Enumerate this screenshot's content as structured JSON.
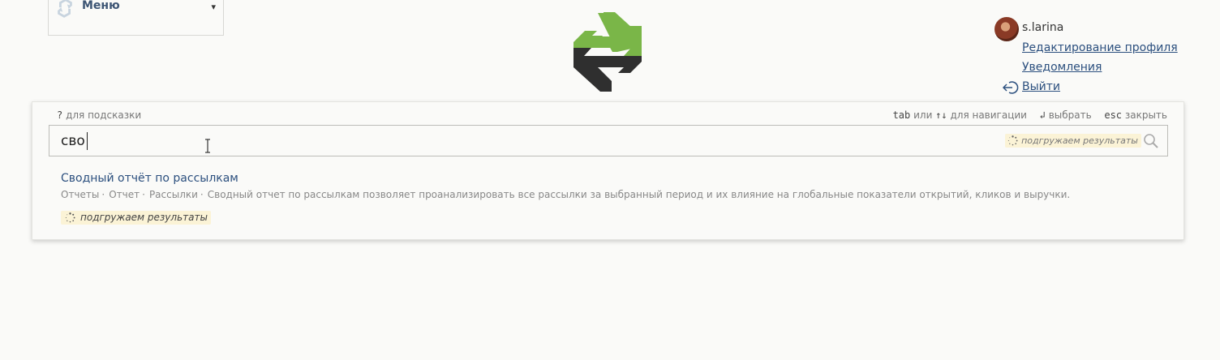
{
  "menu": {
    "label": "Меню",
    "caret": "▾"
  },
  "user": {
    "name": "s.larina",
    "edit_profile": "Редактирование профиля",
    "notifications": "Уведомления",
    "logout": "Выйти"
  },
  "search": {
    "hint_left_key": "?",
    "hint_left_text": "для подсказки",
    "hint_tab_key": "tab",
    "hint_or": "или",
    "hint_arrows": "↑↓",
    "hint_nav": "для навигации",
    "hint_enter_key": "↲",
    "hint_select": "выбрать",
    "hint_esc_key": "esc",
    "hint_close": "закрыть",
    "query": "сво",
    "loading_inline": "подгружаем результаты",
    "loading_bottom": "подгружаем результаты"
  },
  "results": [
    {
      "title": "Сводный отчёт по рассылкам",
      "tags": [
        "Отчеты",
        "Отчет",
        "Рассылки"
      ],
      "separator": "·",
      "description": "Сводный отчет по рассылкам позволяет проанализировать все рассылки за выбранный период и их влияние на глобальные показатели открытий, кликов и выручки."
    }
  ],
  "colors": {
    "logo_green": "#7ab648",
    "logo_dark": "#2f2f2f",
    "link": "#2b4f7e",
    "loading_bg": "#fbf3d6"
  }
}
